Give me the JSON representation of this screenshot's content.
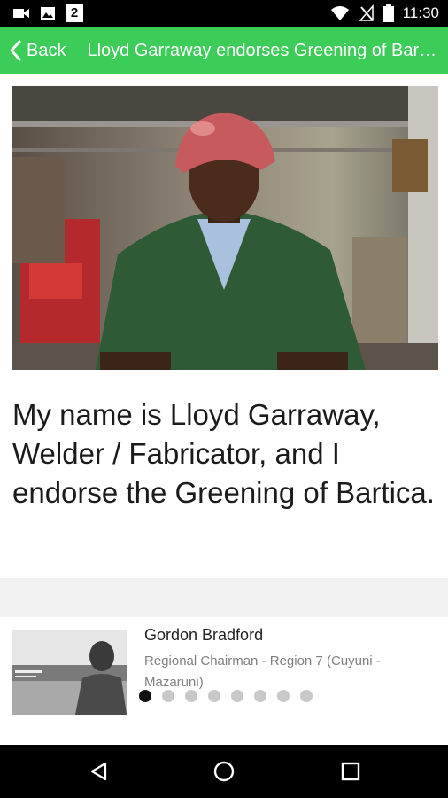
{
  "status_bar": {
    "time": "11:30",
    "notification_count": "2",
    "icons": [
      "video-icon",
      "image-icon",
      "notification-badge",
      "wifi-icon",
      "no-signal-icon",
      "battery-icon"
    ]
  },
  "app_bar": {
    "back_label": "Back",
    "title": "Lloyd Garraway endorses Greening of Bartica",
    "color": "#3ccd59"
  },
  "main": {
    "quote": "My name is Lloyd Garraway, Welder / Fabricator, and I endorse the Greening of Bartica."
  },
  "carousel": {
    "name": "Gordon Bradford",
    "role": "Regional Chairman - Region 7 (Cuyuni - Mazaruni)",
    "dot_count": 8,
    "active_index": 0
  },
  "nav_bar": {
    "buttons": [
      "back-triangle-icon",
      "home-circle-icon",
      "recents-square-icon"
    ]
  }
}
